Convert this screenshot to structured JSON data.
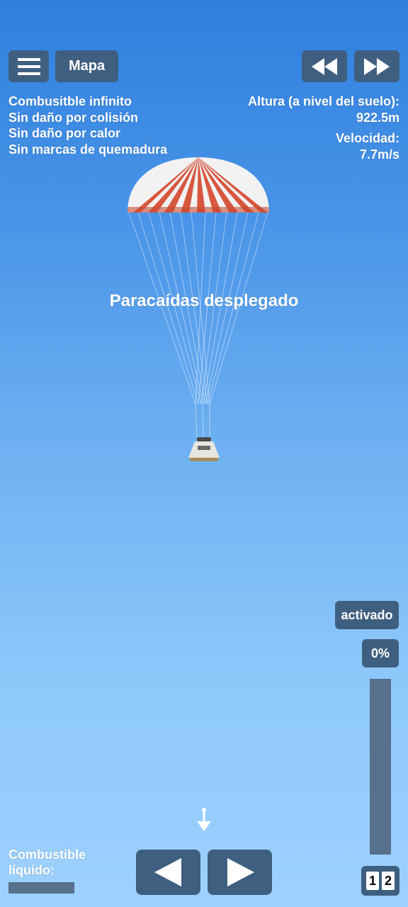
{
  "top_bar": {
    "menu_icon": "hamburger-icon",
    "map_label": "Mapa",
    "rewind_icon": "rewind-icon",
    "fast_forward_icon": "fast-forward-icon"
  },
  "cheats": [
    "Combusitble infinito",
    "Sin daño por colisión",
    "Sin daño por calor",
    "Sin marcas de quemadura"
  ],
  "telemetry": {
    "altitude_label": "Altura (a nivel del suelo):",
    "altitude_value": "922.5m",
    "velocity_label": "Velocidad:",
    "velocity_value": "7.7m/s"
  },
  "status_message": "Paracaídas desplegado",
  "side_controls": {
    "activated_label": "activado",
    "throttle_label": "0%",
    "throttle_fraction": 0
  },
  "bottom": {
    "fuel_label": "Combustible líquido:",
    "fuel_fraction": 1.0,
    "left_icon": "left-arrow-icon",
    "right_icon": "right-arrow-icon",
    "stage_numbers": [
      "1",
      "2"
    ],
    "direction_icon": "down-arrow-icon"
  },
  "colors": {
    "button_bg": "#3f5f80",
    "parachute_red": "#d8573f",
    "parachute_white": "#f2f2f2"
  }
}
